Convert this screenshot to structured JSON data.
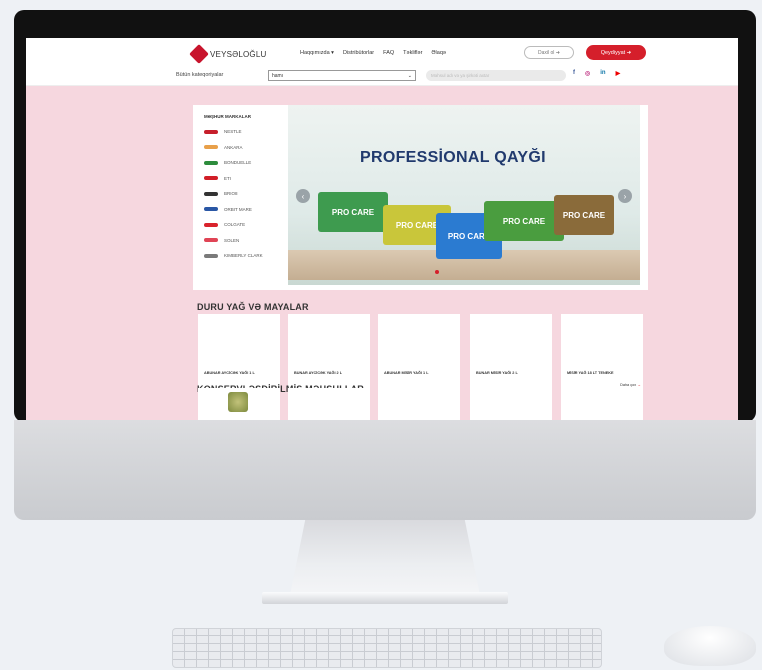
{
  "site": {
    "logo_text": "VEYSƏLOĞLU",
    "nav": [
      "Haqqımızda ▾",
      "Distribütorlar",
      "FAQ",
      "Təkliflər",
      "Əlaqə"
    ],
    "lang_button": "Daxil ol ➜",
    "login_button": "Qeydiyyat ➜",
    "categories_label": "Bütün kateqoriyalar",
    "category_select_value": "hamı",
    "search_placeholder": "Məhsul adı və ya şirkəti axtar",
    "socials": [
      "f",
      "◎",
      "in",
      "▶"
    ],
    "brand_color": "#d51f2b"
  },
  "brands": {
    "title": "MƏŞHUR MARKALAR",
    "items": [
      {
        "name": "NESTLE",
        "color": "#c61f2b"
      },
      {
        "name": "ANKARA",
        "color": "#e8a04a"
      },
      {
        "name": "BONDUELLE",
        "color": "#2d8c3c"
      },
      {
        "name": "ETI",
        "color": "#d11e27"
      },
      {
        "name": "BRIO8",
        "color": "#333333"
      },
      {
        "name": "ORBIT MARE",
        "color": "#2a57a5"
      },
      {
        "name": "COLGATE",
        "color": "#d9232c"
      },
      {
        "name": "SOLEN",
        "color": "#e04455"
      },
      {
        "name": "KIMBERLY CLARK",
        "color": "#7a7a7a"
      }
    ]
  },
  "hero": {
    "title": "PROFESSİONAL QAYĞI",
    "packs": [
      "PRO CARE",
      "PRO CARE",
      "PRO CARE",
      "PRO CARE",
      "PRO CARE"
    ]
  },
  "sections": [
    {
      "title": "DURU YAĞ VƏ MAYALAR",
      "products": [
        "ABUNAR AYCİCƏK YAĞI 1 L",
        "BUNAR AYCİCƏK YAĞI 2 L",
        "ABUNAR MİSİR YAĞI 1 L",
        "BUNAR MİSİR YAĞI 2 L",
        "MİSİR YAĞ 18 LT TENEKE"
      ],
      "more_label": "Daha çox",
      "more_arrow": "→"
    },
    {
      "title": "KONSERVLƏŞDİRİLMİŞ MƏHSULLAR"
    }
  ]
}
